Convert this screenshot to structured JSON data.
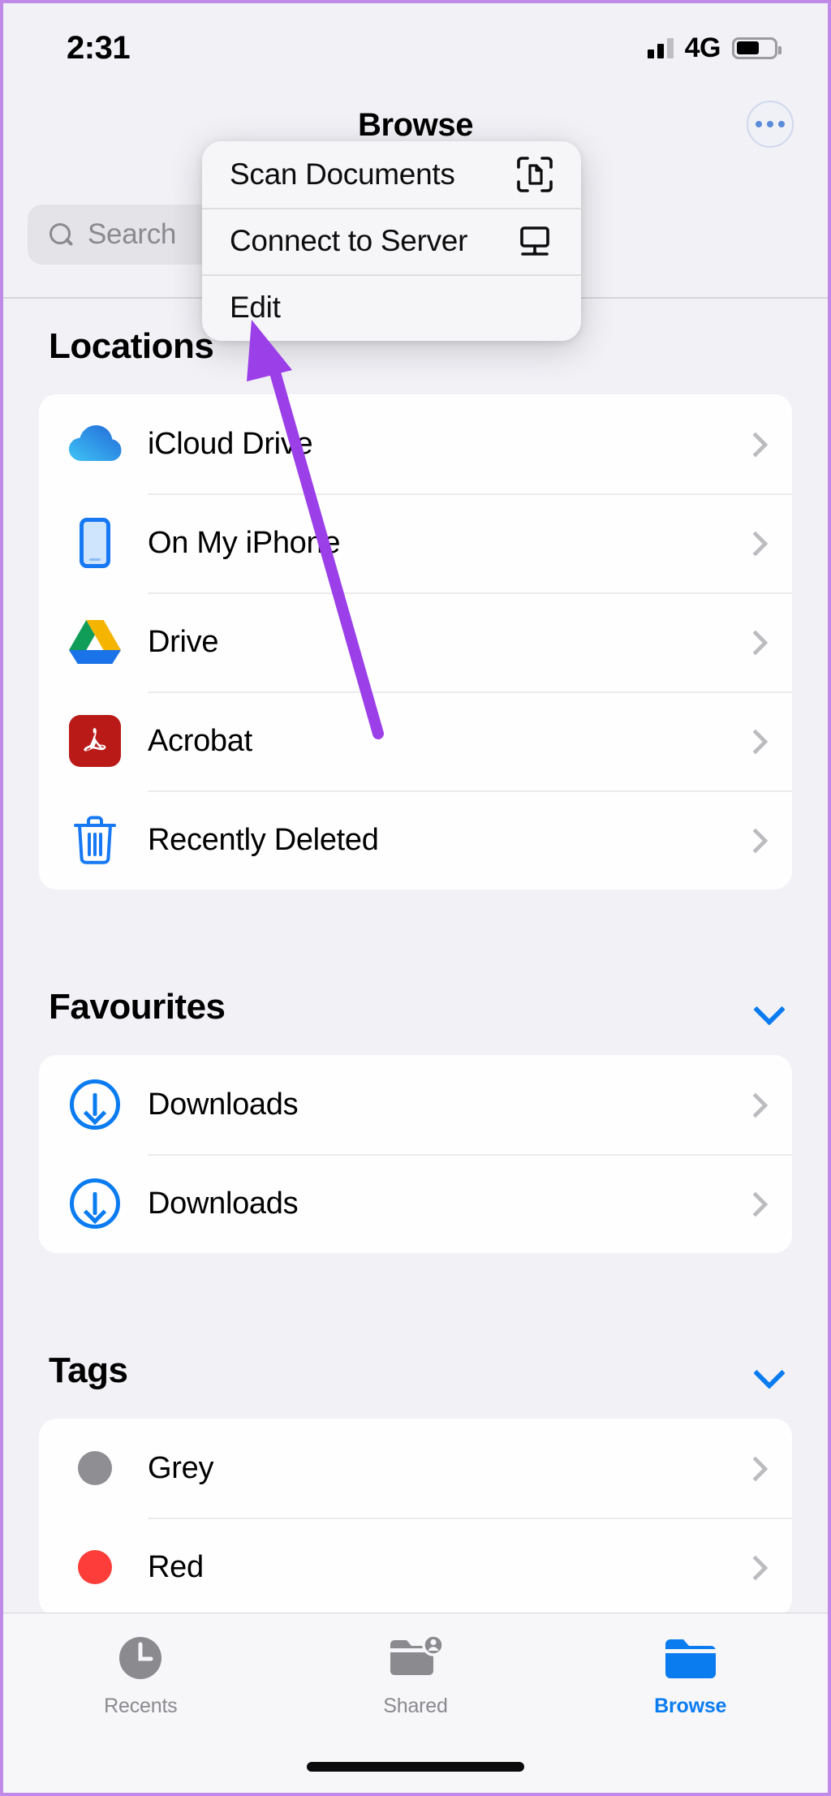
{
  "status_bar": {
    "time": "2:31",
    "network": "4G",
    "signal_icon": "cellular-bars-icon",
    "battery_icon": "battery-icon",
    "battery_level_percent": 62
  },
  "nav": {
    "title": "Browse",
    "more_button_icon": "ellipsis-circle-icon"
  },
  "search": {
    "placeholder": "Search",
    "value": "",
    "icon": "search-icon"
  },
  "context_menu": {
    "items": [
      {
        "label": "Scan Documents",
        "icon": "document-scanner-icon"
      },
      {
        "label": "Connect to Server",
        "icon": "display-server-icon"
      },
      {
        "label": "Edit",
        "icon": ""
      }
    ]
  },
  "annotation": {
    "type": "arrow",
    "color": "#9b3fe8",
    "points_to": "Edit"
  },
  "sections": [
    {
      "title": "Locations",
      "collapsible": false,
      "items": [
        {
          "label": "iCloud Drive",
          "icon": "icloud-drive-icon",
          "chevron": true
        },
        {
          "label": "On My iPhone",
          "icon": "iphone-icon",
          "chevron": true
        },
        {
          "label": "Drive",
          "icon": "google-drive-icon",
          "chevron": true
        },
        {
          "label": "Acrobat",
          "icon": "adobe-acrobat-icon",
          "chevron": true
        },
        {
          "label": "Recently Deleted",
          "icon": "trash-icon",
          "chevron": true
        }
      ]
    },
    {
      "title": "Favourites",
      "collapsible": true,
      "chevron_icon": "chevron-down-icon",
      "items": [
        {
          "label": "Downloads",
          "icon": "download-circle-icon",
          "chevron": true
        },
        {
          "label": "Downloads",
          "icon": "download-circle-icon",
          "chevron": true
        }
      ]
    },
    {
      "title": "Tags",
      "collapsible": true,
      "chevron_icon": "chevron-down-icon",
      "items": [
        {
          "label": "Grey",
          "icon": "tag-dot-icon",
          "color": "#8e8e93",
          "chevron": true
        },
        {
          "label": "Red",
          "icon": "tag-dot-icon",
          "color": "#fc3d39",
          "chevron": true
        }
      ]
    }
  ],
  "tabbar": {
    "tabs": [
      {
        "label": "Recents",
        "icon": "clock-icon",
        "active": false
      },
      {
        "label": "Shared",
        "icon": "folder-person-icon",
        "active": false
      },
      {
        "label": "Browse",
        "icon": "folder-icon",
        "active": true
      }
    ],
    "accent_color": "#0b7cf0",
    "inactive_color": "#8a8a8f"
  }
}
